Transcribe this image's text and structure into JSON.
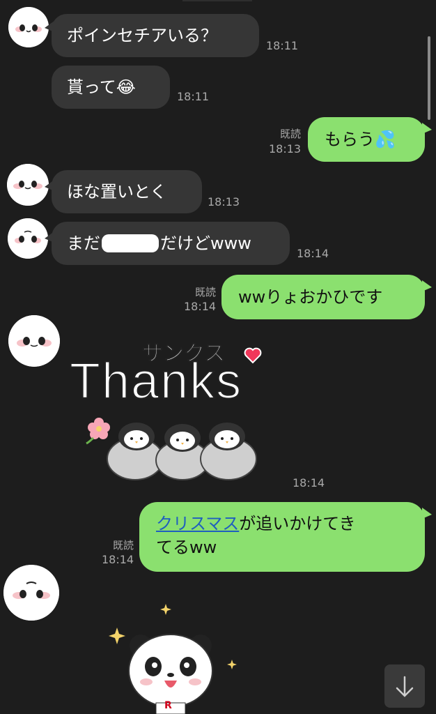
{
  "messages": [
    {
      "text": "ポインセチアいる？",
      "time": "18:11"
    },
    {
      "text": "貰って😂",
      "time": "18:11"
    },
    {
      "text": "もらう💦",
      "time": "18:13",
      "read": "既読"
    },
    {
      "text": "ほな置いとく",
      "time": "18:13"
    },
    {
      "text_before": "まだ",
      "text_after": "だけどwww",
      "time": "18:14"
    },
    {
      "text": "wwりょおかひです",
      "time": "18:14",
      "read": "既読"
    },
    {
      "sticker_title": "Thanks",
      "sticker_sub": "サンクス",
      "time": "18:14"
    },
    {
      "link_text": "クリスマス",
      "text_line1": "が追いかけてき",
      "text_line2": "てるww",
      "time": "18:14",
      "read": "既読"
    }
  ],
  "panda_sticker": {
    "badge": "R"
  },
  "colors": {
    "outgoing": "#8be06f",
    "incoming": "#363636",
    "background": "#1d1d1d"
  },
  "icons": [
    "avatar-face",
    "sparkle-icon",
    "heart-icon",
    "flower-icon",
    "arrow-down-icon"
  ]
}
